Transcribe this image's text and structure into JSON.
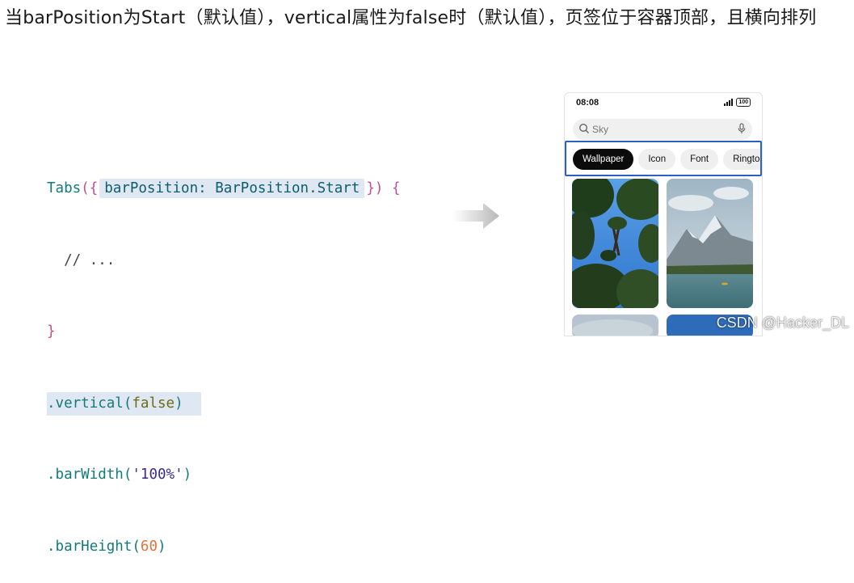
{
  "heading": "当barPosition为Start（默认值），vertical属性为false时（默认值），页签位于容器顶部，且横向排列",
  "code": {
    "line1": {
      "tabs": "Tabs",
      "open_paren": "({",
      "param": "barPosition: BarPosition.Start",
      "close_paren": "})",
      "brace": "{"
    },
    "line2": "// ...",
    "line3": "}",
    "line4": {
      "dot": ".",
      "method": "vertical",
      "open": "(",
      "arg": "false",
      "close": ")"
    },
    "line5": {
      "dot": ".",
      "method": "barWidth",
      "open": "(",
      "arg": "'100%'",
      "close": ")"
    },
    "line6": {
      "dot": ".",
      "method": "barHeight",
      "open": "(",
      "arg": "60",
      "close": ")"
    }
  },
  "phone": {
    "status_time": "08:08",
    "battery": "100",
    "search_placeholder": "Sky",
    "tabs": [
      "Wallpaper",
      "Icon",
      "Font",
      "Ringtone"
    ],
    "active_tab": "Wallpaper"
  },
  "watermark": "CSDN @Hacker_DL",
  "colors": {
    "highlight": "#dfe7f3",
    "tabbar_border": "#2a5fc4",
    "active_tab_bg": "#0b0b0b"
  }
}
